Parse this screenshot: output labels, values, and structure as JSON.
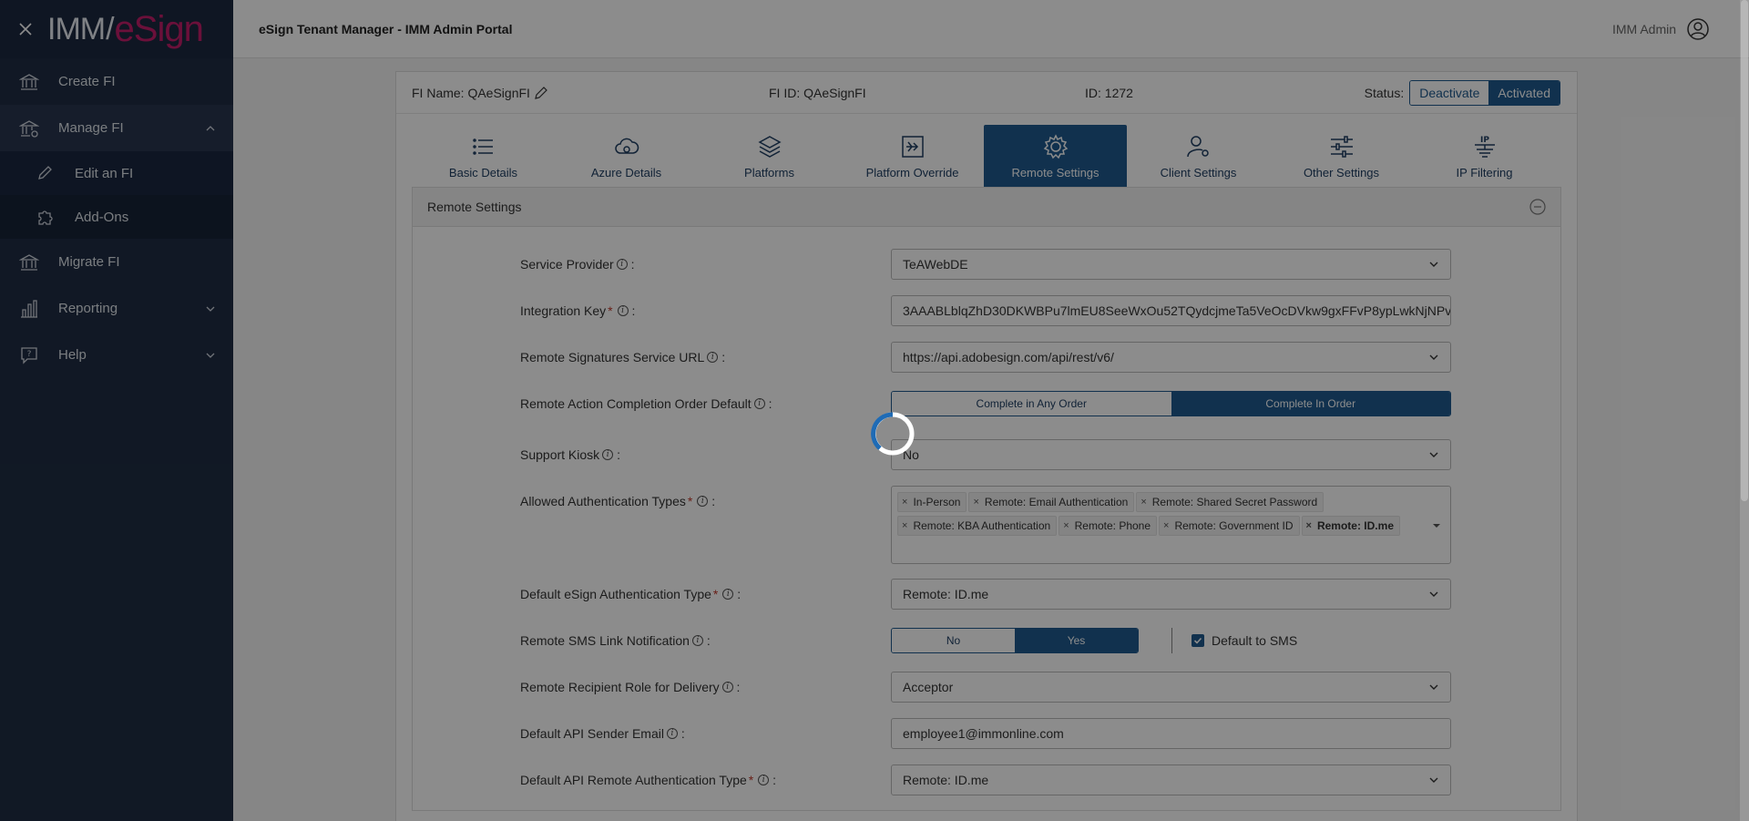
{
  "sidebar": {
    "logo_imm": "IMM",
    "logo_slash": "/",
    "logo_esign": "eSign",
    "items": [
      {
        "label": "Create FI",
        "icon": "bank-icon"
      },
      {
        "label": "Manage FI",
        "icon": "bank-gear-icon"
      },
      {
        "label": "Edit an FI",
        "icon": "pencil-icon"
      },
      {
        "label": "Add-Ons",
        "icon": "puzzle-icon"
      },
      {
        "label": "Migrate FI",
        "icon": "bank-icon"
      },
      {
        "label": "Reporting",
        "icon": "bar-chart-icon"
      },
      {
        "label": "Help",
        "icon": "help-chat-icon"
      }
    ]
  },
  "header": {
    "title": "eSign Tenant Manager - IMM Admin Portal",
    "user": "IMM Admin"
  },
  "fi_info": {
    "name_label": "FI Name: QAeSignFI",
    "id_label": "FI ID: QAeSignFI",
    "num_id": "ID: 1272",
    "status_label": "Status:",
    "deactivate": "Deactivate",
    "activated": "Activated"
  },
  "tabs": [
    {
      "label": "Basic Details",
      "icon": "list-icon"
    },
    {
      "label": "Azure Details",
      "icon": "cloud-icon"
    },
    {
      "label": "Platforms",
      "icon": "layers-icon"
    },
    {
      "label": "Platform Override",
      "icon": "override-icon"
    },
    {
      "label": "Remote Settings",
      "icon": "gear-icon",
      "active": true
    },
    {
      "label": "Client Settings",
      "icon": "user-gear-icon"
    },
    {
      "label": "Other Settings",
      "icon": "sliders-icon"
    },
    {
      "label": "IP Filtering",
      "icon": "ip-icon"
    }
  ],
  "section": {
    "title": "Remote Settings"
  },
  "form": {
    "service_provider": {
      "label": "Service Provider",
      "value": "TeAWebDE"
    },
    "integration_key": {
      "label": "Integration Key",
      "value": "3AAABLblqZhD30DKWBPu7lmEU8SeeWxOu52TQydcjmeTa5VeOcDVkw9gxFFvP8ypLwkNjNPv"
    },
    "remote_sig_url": {
      "label": "Remote Signatures Service URL",
      "value": "https://api.adobesign.com/api/rest/v6/"
    },
    "completion_order": {
      "label": "Remote Action Completion Order Default",
      "opt1": "Complete in Any Order",
      "opt2": "Complete In Order"
    },
    "support_kiosk": {
      "label": "Support Kiosk",
      "value": "No"
    },
    "auth_types": {
      "label": "Allowed Authentication Types",
      "tags": [
        "In-Person",
        "Remote: Email Authentication",
        "Remote: Shared Secret Password",
        "Remote: KBA Authentication",
        "Remote: Phone",
        "Remote: Government ID",
        "Remote: ID.me"
      ]
    },
    "default_auth": {
      "label": "Default eSign Authentication Type",
      "value": "Remote: ID.me"
    },
    "sms_notification": {
      "label": "Remote SMS Link Notification",
      "opt_no": "No",
      "opt_yes": "Yes",
      "checkbox": "Default to SMS"
    },
    "recipient_role": {
      "label": "Remote Recipient Role for Delivery",
      "value": "Acceptor"
    },
    "api_sender_email": {
      "label": "Default API Sender Email",
      "value": "employee1@immonline.com"
    },
    "api_remote_auth": {
      "label": "Default API Remote Authentication Type",
      "value": "Remote: ID.me"
    },
    "suffix": ":"
  }
}
